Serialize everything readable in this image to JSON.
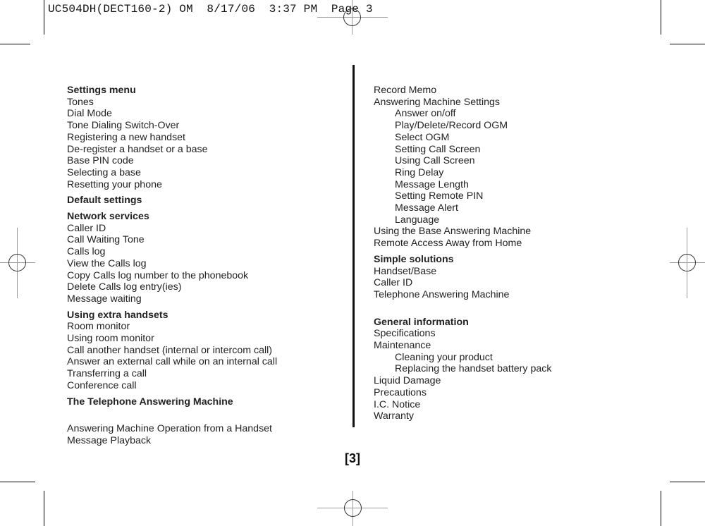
{
  "slug_line": "UC504DH(DECT160-2) OM  8/17/06  3:37 PM  Page 3",
  "page_number": "[3]",
  "left_column": [
    {
      "text": "Settings menu",
      "type": "heading"
    },
    {
      "text": "Tones",
      "type": "item"
    },
    {
      "text": "Dial Mode",
      "type": "item"
    },
    {
      "text": "Tone Dialing Switch-Over",
      "type": "item"
    },
    {
      "text": "Registering a new handset",
      "type": "item"
    },
    {
      "text": "De-register a handset or a base",
      "type": "item"
    },
    {
      "text": "Base PIN code",
      "type": "item"
    },
    {
      "text": "Selecting a base",
      "type": "item"
    },
    {
      "text": "Resetting your phone",
      "type": "item"
    },
    {
      "text": "Default settings",
      "type": "heading"
    },
    {
      "text": "Network services",
      "type": "heading"
    },
    {
      "text": "Caller ID",
      "type": "item"
    },
    {
      "text": "Call Waiting Tone",
      "type": "item"
    },
    {
      "text": "Calls log",
      "type": "item"
    },
    {
      "text": "View the Calls log",
      "type": "item"
    },
    {
      "text": "Copy Calls log number to the phonebook",
      "type": "item"
    },
    {
      "text": "Delete Calls log entry(ies)",
      "type": "item"
    },
    {
      "text": "Message waiting",
      "type": "item"
    },
    {
      "text": "Using extra handsets",
      "type": "heading"
    },
    {
      "text": "Room monitor",
      "type": "item"
    },
    {
      "text": "Using room monitor",
      "type": "item"
    },
    {
      "text": "Call another handset (internal or intercom call)",
      "type": "item"
    },
    {
      "text": "Answer an external call while on an internal call",
      "type": "item"
    },
    {
      "text": "Transferring a call",
      "type": "item"
    },
    {
      "text": "Conference call",
      "type": "item"
    },
    {
      "text": "The Telephone Answering Machine",
      "type": "heading"
    },
    {
      "text": "Answering Machine Operation from a Handset",
      "type": "item-gap"
    },
    {
      "text": "Message Playback",
      "type": "item"
    }
  ],
  "right_column": [
    {
      "text": "Record Memo",
      "type": "item"
    },
    {
      "text": "Answering Machine Settings",
      "type": "item"
    },
    {
      "text": "Answer on/off",
      "type": "sub"
    },
    {
      "text": "Play/Delete/Record OGM",
      "type": "sub"
    },
    {
      "text": "Select OGM",
      "type": "sub"
    },
    {
      "text": "Setting Call Screen",
      "type": "sub"
    },
    {
      "text": "Using Call Screen",
      "type": "sub"
    },
    {
      "text": "Ring Delay",
      "type": "sub"
    },
    {
      "text": "Message Length",
      "type": "sub"
    },
    {
      "text": "Setting Remote PIN",
      "type": "sub"
    },
    {
      "text": "Message Alert",
      "type": "sub"
    },
    {
      "text": "Language",
      "type": "sub"
    },
    {
      "text": "Using the Base Answering Machine",
      "type": "item"
    },
    {
      "text": "Remote Access Away from Home",
      "type": "item"
    },
    {
      "text": "Simple solutions",
      "type": "heading"
    },
    {
      "text": "Handset/Base",
      "type": "item"
    },
    {
      "text": "Caller ID",
      "type": "item"
    },
    {
      "text": "Telephone Answering Machine",
      "type": "item"
    },
    {
      "text": "General information",
      "type": "heading-gap"
    },
    {
      "text": "Specifications",
      "type": "item"
    },
    {
      "text": "Maintenance",
      "type": "item"
    },
    {
      "text": "Cleaning your product",
      "type": "sub"
    },
    {
      "text": "Replacing the handset battery pack",
      "type": "sub"
    },
    {
      "text": "Liquid Damage",
      "type": "item"
    },
    {
      "text": "Precautions",
      "type": "item"
    },
    {
      "text": "I.C. Notice",
      "type": "item"
    },
    {
      "text": "Warranty",
      "type": "item"
    }
  ]
}
